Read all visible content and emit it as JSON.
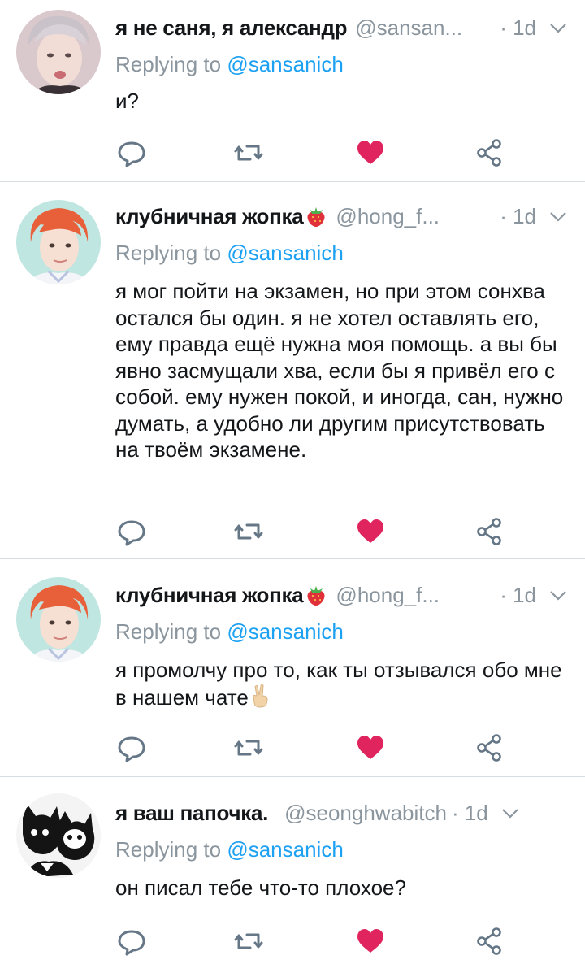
{
  "tweets": [
    {
      "name": "я не саня, я александр",
      "handle": "@sansan...",
      "time": "· 1d",
      "reply_prefix": "Replying to",
      "reply_to": "@sansanich",
      "text": "и?",
      "avatar_icon": "user-avatar-icon"
    },
    {
      "name": "клубничная жопка",
      "handle": "@hong_f...",
      "time": "· 1d",
      "reply_prefix": "Replying to",
      "reply_to": "@sansanich",
      "text": "я мог пойти на экзамен, но при этом сонхва остался бы один. я не хотел оставлять его, ему правда ещё нужна моя помощь. а вы бы явно засмущали хва, если бы я привёл его с собой. ему нужен покой, и иногда, сан, нужно думать, а удобно ли другим присутствовать на твоём экзамене.",
      "name_emoji": "strawberry-icon",
      "avatar_icon": "user-avatar-icon"
    },
    {
      "name": "клубничная жопка",
      "handle": "@hong_f...",
      "time": "· 1d",
      "reply_prefix": "Replying to",
      "reply_to": "@sansanich",
      "text": "я промолчу про то, как ты отзывался обо мне в нашем чате",
      "name_emoji": "strawberry-icon",
      "text_emoji": "victory-hand-icon",
      "avatar_icon": "user-avatar-icon"
    },
    {
      "name": "я ваш папочка.",
      "handle": "@seonghwabitch",
      "time": "· 1d",
      "reply_prefix": "Replying to",
      "reply_to": "@sansanich",
      "text": "он писал тебе что-то плохое?",
      "avatar_icon": "cats-avatar-icon"
    }
  ],
  "colors": {
    "link": "#1da1f2",
    "muted": "#8a959e",
    "like": "#e0245e",
    "divider": "#d6dce1"
  },
  "icons": [
    "reply-icon",
    "retweet-icon",
    "like-heart-icon",
    "share-icon",
    "chevron-down-icon"
  ]
}
